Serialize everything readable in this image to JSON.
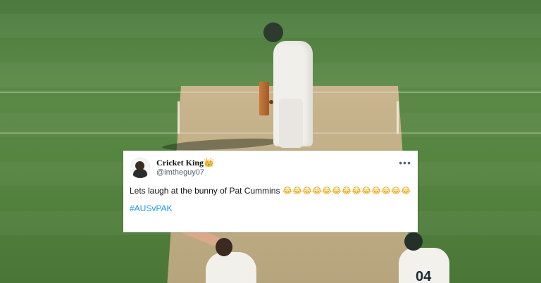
{
  "tweet": {
    "display_name": "Cricket King",
    "name_badge": "👑",
    "handle": "@imtheguy07",
    "more_glyph": "•••",
    "text": "Lets laugh at the bunny of Pat Cummins",
    "emojis": "😂😂😂😂😂😂😂😂😂😂😂😂😂",
    "hashtag": "#AUSvPAK"
  },
  "scene": {
    "fielder_number": "04"
  },
  "colors": {
    "grass": "#55843f",
    "pitch": "#c2b088",
    "hashtag": "#1d9bf0",
    "handle": "#536471"
  },
  "icons": {
    "more": "more-options-icon",
    "badge": "crown-icon"
  }
}
